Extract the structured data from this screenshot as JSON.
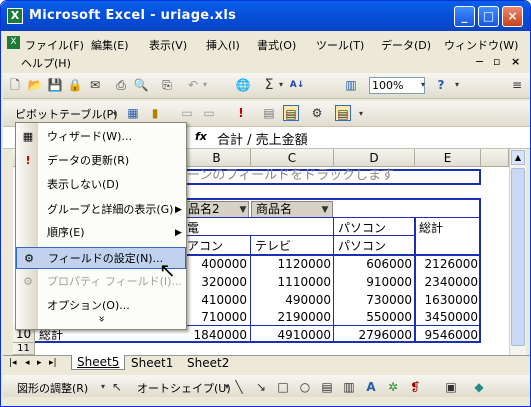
{
  "window": {
    "title": "Microsoft Excel - uriage.xls",
    "app_icon": "X",
    "min": "_",
    "max": "□",
    "close": "×"
  },
  "menubar": {
    "items": [
      "ファイル(F)",
      "編集(E)",
      "表示(V)",
      "挿入(I)",
      "書式(O)",
      "ツール(T)",
      "データ(D)",
      "ウィンドウ(W)"
    ],
    "help": "ヘルプ(H)",
    "zoom": "100%"
  },
  "pivot_toolbar": {
    "label": "ピボットテーブル(P)"
  },
  "formula": {
    "fx": "fx",
    "content": "合計 / 売上金額"
  },
  "grid": {
    "columns": [
      "B",
      "C",
      "D",
      "E"
    ],
    "rows": [
      "10",
      "11"
    ],
    "drop_hint": "ーンのフィールドをドラックします",
    "field1": "品名2",
    "field2": "商品名",
    "cat1": "電",
    "cat2": "パソコン",
    "total_label": "総計",
    "sub1": "アコン",
    "sub2": "テレビ",
    "sub3": "パソコン",
    "data": [
      [
        "400000",
        "1120000",
        "606000",
        "2126000"
      ],
      [
        "320000",
        "1110000",
        "910000",
        "2340000"
      ],
      [
        "410000",
        "490000",
        "730000",
        "1630000"
      ],
      [
        "710000",
        "2190000",
        "550000",
        "3450000"
      ],
      [
        "1840000",
        "4910000",
        "2796000",
        "9546000"
      ]
    ],
    "grand_label": "総計"
  },
  "sheets": {
    "tabs": [
      "Sheet5",
      "Sheet1",
      "Sheet2"
    ]
  },
  "drawbar": {
    "shape_adjust": "図形の調整(R)",
    "autoshape": "オートシェイプ(U)"
  },
  "dropdown": {
    "items": [
      "ウィザード(W)...",
      "データの更新(R)",
      "表示しない(D)",
      "グループと詳細の表示(G)",
      "順序(E)",
      "フィールドの設定(N)...",
      "プロパティ フィールド(I)...",
      "オプション(O)..."
    ],
    "more": "»"
  }
}
